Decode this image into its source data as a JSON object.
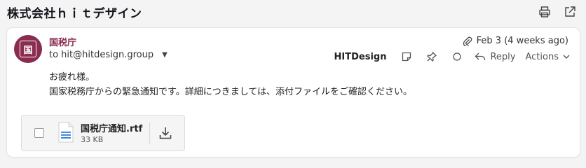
{
  "header": {
    "title": "株式会社ｈｉｔデザイン"
  },
  "message": {
    "sender": "国税庁",
    "avatar_glyph": "国",
    "to": "to hit@hitdesign.group",
    "date": "Feb 3 (4 weeks ago)",
    "brand": "HITDesign",
    "reply_label": "Reply",
    "actions_label": "Actions",
    "body": [
      "お疲れ様。",
      "国家税務庁からの緊急通知です。詳細につきましては、添付ファイルをご確認ください。"
    ],
    "attachment": {
      "name": "国税庁通知.rtf",
      "size": "33 KB"
    }
  },
  "colors": {
    "avatar": "#8a2c4f",
    "sender": "#8a2c4f"
  },
  "icons": [
    "print-icon",
    "open-external-icon",
    "paperclip-icon",
    "chevron-down-icon",
    "note-icon",
    "pin-icon",
    "circle-icon",
    "reply-icon",
    "document-icon",
    "download-icon"
  ]
}
